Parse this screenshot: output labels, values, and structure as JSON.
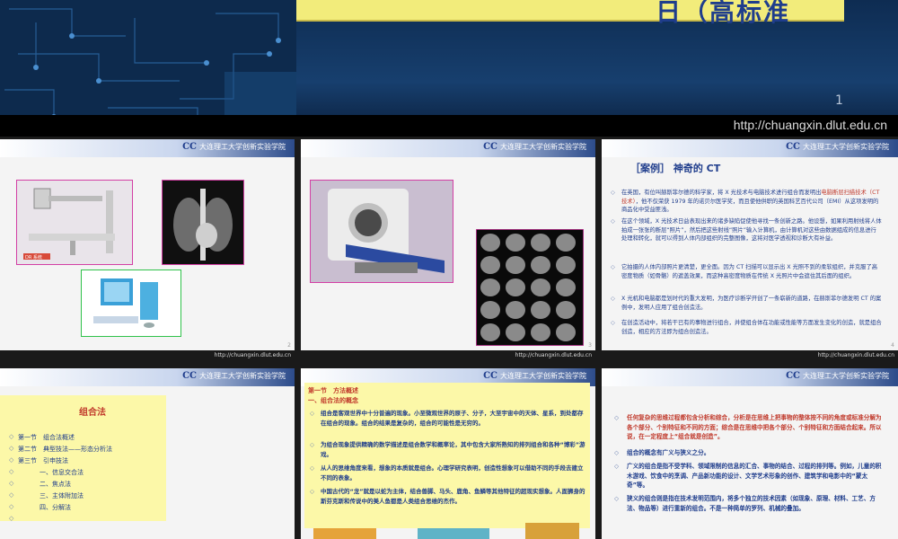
{
  "slide1": {
    "title_fragment": "日（高标准",
    "page_num": "1",
    "url": "http://chuangxin.dlut.edu.cn"
  },
  "header_logo": {
    "symbol": "CC",
    "text": "大连理工大学创新实验学院"
  },
  "footer_url": "http://chuangxin.dlut.edu.cn",
  "slide2": {
    "page": "2",
    "label": "DR 系统"
  },
  "slide3": {
    "page": "3"
  },
  "slide4": {
    "page": "4",
    "title_bracket": "［案例］",
    "title_text": "神奇的 CT",
    "bullets": [
      {
        "pre": "在英国，有位叫赫斯菲尔德的科学家，将 X 光技术与电脑技术进行组合而发明出",
        "red": "电脑断层扫描技术（CT 技术）",
        "post": "，他不仅荣获 1979 年的诺贝尔医学奖，而且使他供职的英国科艺百代公司（EMI）从这项发明的商品化中受益匪浅。"
      },
      {
        "pre": "在这个领域，X 光技术日益表现出来的诸多缺陷促使他寻找一条创新之路。他设想，如果利用射线将人体拍成一张张的断层“照片”，然后把这些射线“照片”输入计算机，由计算机对这些由数据组成的信息进行处理和转化，就可以得到人体内部组织的完整图像，这将对医学透视和诊断大有补益。",
        "red": "",
        "post": ""
      },
      {
        "pre": "它拍摄的人体内部照片更清楚，更全面。因为 CT 扫描可以显示出 X 光照不到的柔软组织，并克服了高密度物质（如骨骼）的遮盖效果，而这种高密度物质在传统 X 光照片中会遮住其后面的组织。",
        "red": "",
        "post": ""
      },
      {
        "pre": "X 光机和电脑都是划时代的重大发明，为医疗诊断学开创了一条崭新的道路，在赫斯菲尔德发明 CT 的案例中，发明人应用了组合创造法。",
        "red": "",
        "post": ""
      },
      {
        "pre": "在创造活动中，将若干已有的事物进行组合，并使组合体在功能或性能等方面发生变化的创造，就是组合创造，相应的方法即为组合创造法。",
        "red": "",
        "post": ""
      }
    ]
  },
  "slide5": {
    "title": "组合法",
    "items": [
      "第一节　组合法概述",
      "第二节　典型技法——形态分析法",
      "第三节　引申技法",
      "一、信息交合法",
      "二、焦点法",
      "三、主体附加法",
      "四、分解法",
      ""
    ]
  },
  "slide6": {
    "section": "第一节　方法概述",
    "sub": "一、组合法的概念",
    "paras": [
      "组合是客观世界中十分普遍的现象。小至微观世界的原子、分子，大至宇宙中的天体、星系，到处都存在组合的现象。组合的结果是复杂的，组合的可能性是无穷的。",
      "为组合现象提供精确的数学描述是组合数学和概率论，其中包含大家所熟知的排列组合和各种“博彩”游戏。",
      "从人的思维角度来看，想象的本质就是组合。心理学研究表明，创造性想象可以借助不同的手段去建立不同的表象。",
      "中国古代的“龙”就是以蛇为主体，结合兽脚、马头、鹿角、鱼鳞等其他特征的超现实想象。人面狮身的斯芬克斯和传说中的美人鱼都是人类组合思维的杰作。"
    ]
  },
  "slide7": {
    "paras": [
      "任何复杂的思维过程都包含分析和综合，分析是在思维上把事物的整体按不同的角度或标准分解为各个部分、个别特征和不同的方面；综合是在思维中把各个部分、个别特征和方面结合起来。所以说，在一定程度上“组合就是创造”。",
      "组合的概念有广义与狭义之分。",
      "广义的组合是指不受学科、领域限制的信息的汇合、事物的结合、过程的排列等。例如，儿童的积木游戏、饮食中的烹调、产品新功能的设计、文学艺术形象的创作、建筑学和电影中的“蒙太奇”等。",
      "狭义的组合则是指在技术发明范围内，将多个独立的技术因素（如现象、原理、材料、工艺、方法、物品等）进行重新的组合。不是一种简单的罗列、机械的叠加。"
    ]
  },
  "colors": {
    "accent_blue": "#1f3d8c",
    "accent_red": "#c0392b",
    "yellow_box": "#fcf8a8"
  }
}
